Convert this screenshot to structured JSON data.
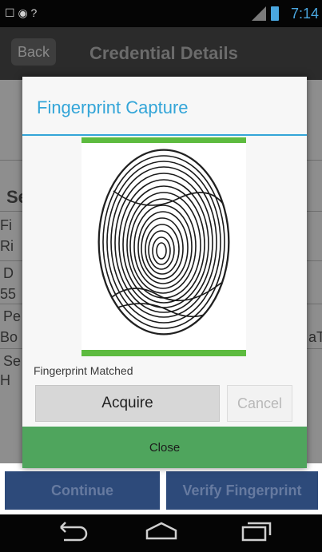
{
  "status_bar": {
    "time": "7:14",
    "left_icons": "☐ ◉ ?"
  },
  "header": {
    "back_label": "Back",
    "title": "Credential Details"
  },
  "background": {
    "letters": [
      "Se",
      "Fi",
      "Ri",
      "D",
      "55",
      "Pe",
      "Bo",
      "Se",
      "H"
    ],
    "right_text": "aT"
  },
  "bottom_buttons": {
    "continue_label": "Continue",
    "verify_label": "Verify Fingerprint"
  },
  "dialog": {
    "title": "Fingerprint Capture",
    "status_text": "Fingerprint Matched",
    "acquire_label": "Acquire",
    "cancel_label": "Cancel",
    "close_label": "Close"
  },
  "nav": {
    "back_icon": "back-arrow-icon",
    "home_icon": "home-icon",
    "recents_icon": "recents-icon"
  },
  "colors": {
    "accent": "#33a5d8",
    "success_bar": "#5dbb3f",
    "close_bg": "#4fa55d",
    "button_blue": "#2d4a7a"
  }
}
